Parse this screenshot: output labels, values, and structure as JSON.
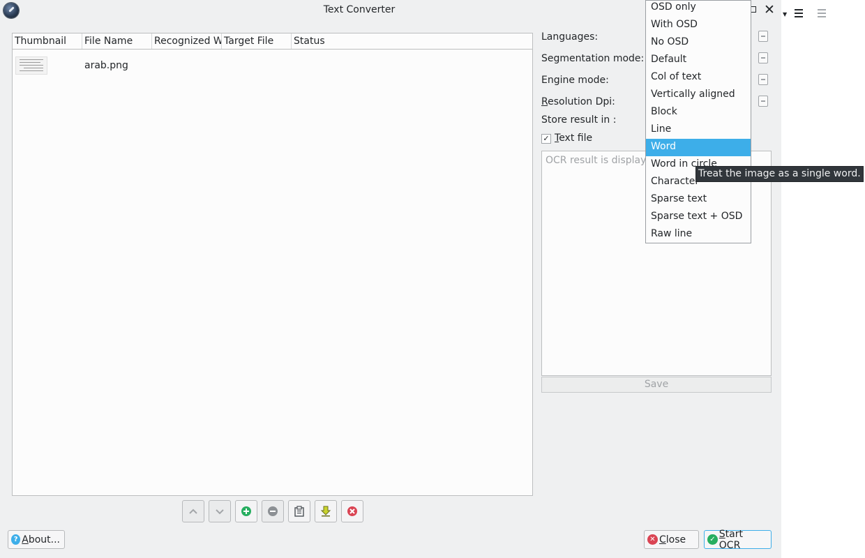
{
  "window": {
    "title": "Text Converter"
  },
  "table": {
    "columns": [
      "Thumbnail",
      "File Name",
      "Recognized W",
      "Target File",
      "Status"
    ],
    "rows": [
      {
        "file_name": "arab.png",
        "recognized": "",
        "target": "",
        "status": ""
      }
    ]
  },
  "settings": {
    "languages_label": "Languages:",
    "segmentation_label": "Segmentation mode:",
    "engine_label": "Engine mode:",
    "resolution_label_first": "R",
    "resolution_label_rest": "esolution Dpi:",
    "store_label": "Store result in :",
    "text_file_label_first": "T",
    "text_file_label_rest": "ext file",
    "text_file_checked": true,
    "checkmark": "✓"
  },
  "ocr_result": {
    "placeholder": "OCR result is displaye",
    "save_label": "Save"
  },
  "dropdown": {
    "items": [
      "OSD only",
      "With OSD",
      "No OSD",
      "Default",
      "Col of text",
      "Vertically aligned",
      "Block",
      "Line",
      "Word",
      "Word in circle",
      "Character",
      "Sparse text",
      "Sparse text + OSD",
      "Raw line"
    ],
    "selected": "Word"
  },
  "tooltip": {
    "text": "Treat the image as a single word."
  },
  "buttons": {
    "about_first": "A",
    "about_rest": "bout...",
    "close_first": "C",
    "close_rest": "lose",
    "start_first": "S",
    "start_rest": "tart OCR"
  },
  "toolbar_icons": [
    "move-up-icon",
    "move-down-icon",
    "add-icon",
    "remove-icon",
    "paste-icon",
    "download-icon",
    "clear-icon"
  ],
  "colors": {
    "accent": "#3daee9",
    "green": "#27ae60",
    "red": "#da4453",
    "background": "#eff0f1"
  }
}
